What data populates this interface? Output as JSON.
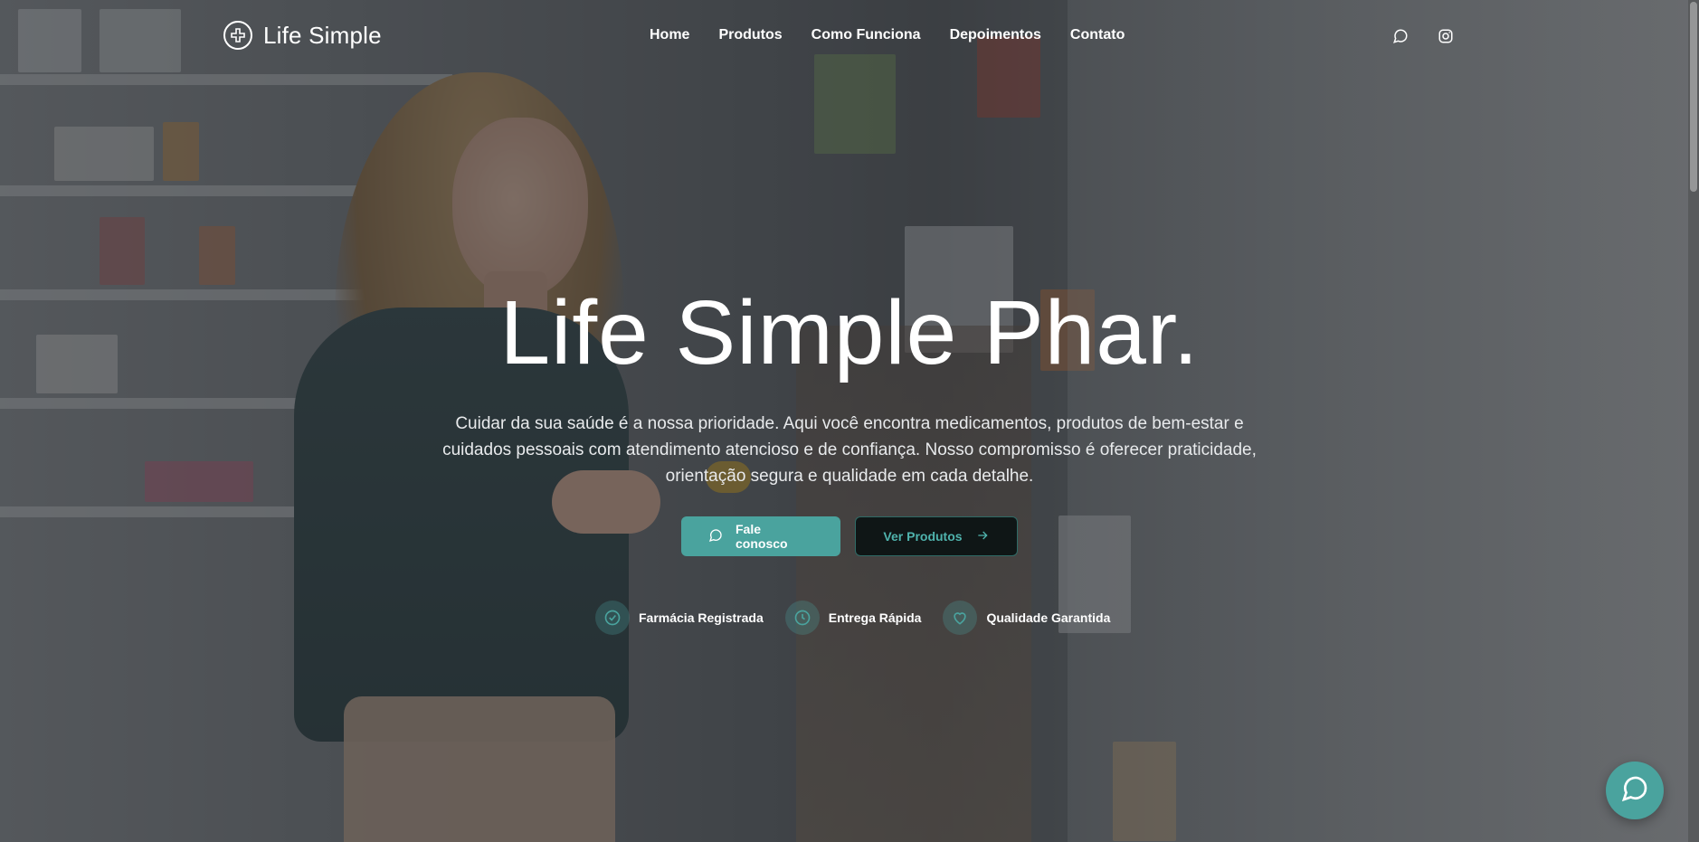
{
  "brand": {
    "name": "Life Simple",
    "accent": "#4aa39e"
  },
  "nav": {
    "items": [
      {
        "label": "Home"
      },
      {
        "label": "Produtos"
      },
      {
        "label": "Como Funciona"
      },
      {
        "label": "Depoimentos"
      },
      {
        "label": "Contato"
      }
    ],
    "icons": [
      "message-circle-icon",
      "instagram-icon"
    ]
  },
  "hero": {
    "title": "Life Simple Phar.",
    "subtitle": "Cuidar da sua saúde é a nossa prioridade. Aqui você encontra medicamentos, produtos de bem-estar e cuidados pessoais com atendimento atencioso e de confiança. Nosso compromisso é oferecer praticidade, orientação segura e qualidade em cada detalhe.",
    "primary_button": "Fale conosco",
    "secondary_button": "Ver Produtos"
  },
  "badges": [
    {
      "label": "Farmácia Registrada",
      "icon": "check-circle-icon"
    },
    {
      "label": "Entrega Rápida",
      "icon": "clock-icon"
    },
    {
      "label": "Qualidade Garantida",
      "icon": "heart-icon"
    }
  ],
  "floating_chat": {
    "icon": "message-circle-icon"
  }
}
